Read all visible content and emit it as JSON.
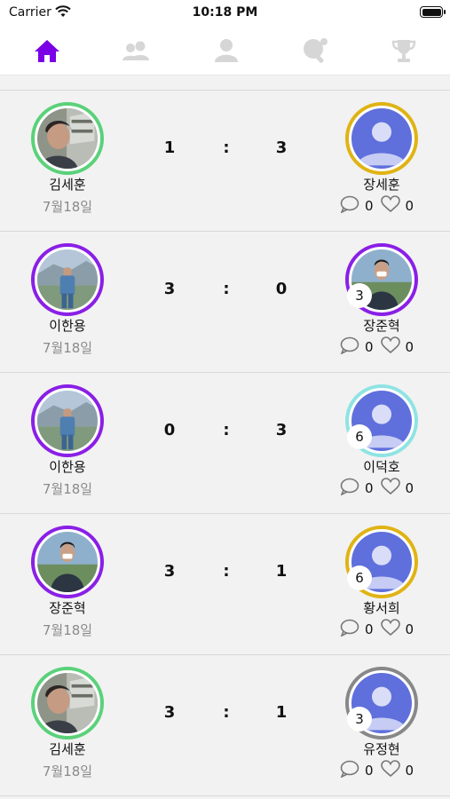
{
  "status_bar": {
    "carrier": "Carrier",
    "time": "10:18 PM"
  },
  "tabs": [
    {
      "icon": "home-icon",
      "active": true
    },
    {
      "icon": "friends-icon",
      "active": false
    },
    {
      "icon": "profile-icon",
      "active": false
    },
    {
      "icon": "table-tennis-icon",
      "active": false
    },
    {
      "icon": "trophy-icon",
      "active": false
    }
  ],
  "colors": {
    "accent": "#7b00e6",
    "inactive_icon": "#d6d6d6"
  },
  "matches": [
    {
      "left_name": "김세훈",
      "left_ring": "#5bd17a",
      "left_photo": "selfie",
      "date": "7월18일",
      "score_left": "1",
      "score_right": "3",
      "right_name": "장세훈",
      "right_ring": "#e0b314",
      "right_photo": "default",
      "right_level": "",
      "comments": "0",
      "likes": "0"
    },
    {
      "left_name": "이한용",
      "left_ring": "#8a1fe6",
      "left_photo": "coast",
      "date": "7월18일",
      "score_left": "3",
      "score_right": "0",
      "right_name": "장준혁",
      "right_ring": "#8a1fe6",
      "right_photo": "portrait",
      "right_level": "3",
      "comments": "0",
      "likes": "0"
    },
    {
      "left_name": "이한용",
      "left_ring": "#8a1fe6",
      "left_photo": "coast",
      "date": "7월18일",
      "score_left": "0",
      "score_right": "3",
      "right_name": "이덕호",
      "right_ring": "#8fe3e3",
      "right_photo": "default",
      "right_level": "6",
      "comments": "0",
      "likes": "0"
    },
    {
      "left_name": "장준혁",
      "left_ring": "#8a1fe6",
      "left_photo": "portrait",
      "date": "7월18일",
      "score_left": "3",
      "score_right": "1",
      "right_name": "황서희",
      "right_ring": "#e0b314",
      "right_photo": "default",
      "right_level": "6",
      "comments": "0",
      "likes": "0"
    },
    {
      "left_name": "김세훈",
      "left_ring": "#5bd17a",
      "left_photo": "selfie",
      "date": "7월18일",
      "score_left": "3",
      "score_right": "1",
      "right_name": "유정현",
      "right_ring": "#888888",
      "right_photo": "default",
      "right_level": "3",
      "comments": "0",
      "likes": "0"
    }
  ],
  "score_separator": ":"
}
